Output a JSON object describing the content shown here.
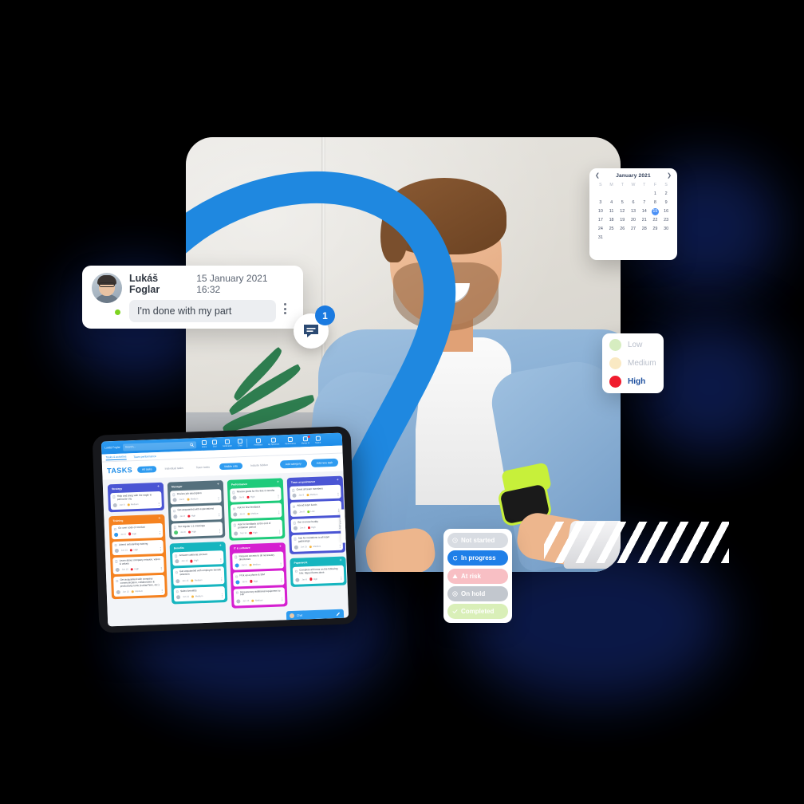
{
  "calendar": {
    "title": "January 2021",
    "prev_icon": "chevron-left-icon",
    "next_icon": "chevron-right-icon",
    "weekdays": [
      "S",
      "M",
      "T",
      "W",
      "T",
      "F",
      "S"
    ],
    "leading_blanks": 5,
    "days": [
      1,
      2,
      3,
      4,
      5,
      6,
      7,
      8,
      9,
      10,
      11,
      12,
      13,
      14,
      15,
      16,
      17,
      18,
      19,
      20,
      21,
      22,
      23,
      24,
      25,
      26,
      27,
      28,
      29,
      30,
      31
    ],
    "selected_day": 15,
    "accent": "#4a90f7"
  },
  "comment": {
    "author": "Lukáš Foglar",
    "timestamp": "15 January 2021 16:32",
    "message": "I'm done with my part",
    "menu_icon": "kebab-menu-icon",
    "online_status_color": "#7ed321",
    "chat_icon": "chat-bubble-icon",
    "unread_count": "1",
    "badge_color": "#1a7ae0"
  },
  "priority_legend": {
    "items": [
      {
        "label": "Low",
        "color": "#d6edc0"
      },
      {
        "label": "Medium",
        "color": "#fae9c3"
      },
      {
        "label": "High",
        "color": "#f01c2e"
      }
    ]
  },
  "statuses": {
    "items": [
      {
        "label": "Not started",
        "icon": "clock-icon",
        "bg": "#d8dce2",
        "fg": "#ffffff"
      },
      {
        "label": "In progress",
        "icon": "refresh-icon",
        "bg": "#1f7fe8",
        "fg": "#ffffff"
      },
      {
        "label": "At risk",
        "icon": "warning-icon",
        "bg": "#f8bfc4",
        "fg": "#ffffff"
      },
      {
        "label": "On hold",
        "icon": "pause-icon",
        "bg": "#c2c7ce",
        "fg": "#ffffff"
      },
      {
        "label": "Completed",
        "icon": "check-icon",
        "bg": "#d9efb8",
        "fg": "#ffffff"
      }
    ]
  },
  "tablet": {
    "toolbar": {
      "user": "Lukáš Foglar",
      "search_placeholder": "Search...",
      "search_icon": "search-icon",
      "icons": [
        {
          "label": "Home",
          "icon": "home-icon"
        },
        {
          "label": "Grid",
          "icon": "grid-icon"
        },
        {
          "label": "Notification",
          "icon": "bell-icon"
        },
        {
          "label": "Chat",
          "icon": "chat-icon"
        }
      ],
      "icons2": [
        {
          "label": "Feedback",
          "icon": "feedback-icon"
        },
        {
          "label": "My Spectrum",
          "icon": "spectrum-icon"
        },
        {
          "label": "Performance",
          "icon": "chart-icon"
        },
        {
          "label": "Mentor AI",
          "icon": "mentor-icon",
          "badge": true
        },
        {
          "label": "Switch",
          "icon": "switch-icon"
        }
      ]
    },
    "subnav": [
      {
        "label": "Tasks & activities",
        "active": true
      },
      {
        "label": "Team performance",
        "active": false
      }
    ],
    "header": {
      "title": "TASKS",
      "filters": [
        {
          "label": "All tasks",
          "active": true
        },
        {
          "label": "Individual tasks",
          "active": false
        },
        {
          "label": "Team tasks",
          "active": false
        }
      ],
      "visibility": [
        {
          "label": "Visible only",
          "active": true
        },
        {
          "label": "Include hidden",
          "active": false
        }
      ],
      "actions": [
        {
          "label": "Add category"
        },
        {
          "label": "Add new task"
        }
      ]
    },
    "side_tab": "Switch view",
    "chat_bar": {
      "label": "Chat",
      "edit_icon": "pencil-icon"
    },
    "columns": [
      {
        "name": "Strategy",
        "color": "#4a55d4",
        "cards": [
          {
            "title": "Help and bring with the eagle to particular city",
            "date": "Jan 8",
            "priority": "Medium",
            "priority_color": "#f5b642",
            "avatar": "gray"
          }
        ]
      },
      {
        "name": "Training",
        "color": "#f58220",
        "cards": [
          {
            "title": "Go over code of conduct",
            "date": "Jan 8",
            "priority": "High",
            "priority_color": "#f01c2e",
            "avatar": "blue"
          },
          {
            "title": "Attend onboarding training",
            "date": "Jan 15",
            "priority": "High",
            "priority_color": "#f01c2e",
            "avatar": "gray"
          },
          {
            "title": "Learn about company mission, vision & values",
            "date": "Jan 15",
            "priority": "High",
            "priority_color": "#f01c2e",
            "avatar": "gray"
          },
          {
            "title": "Get acquainted with company communication, collaboration & productivity tools (LudianTime, etc.)",
            "date": "Jan 15",
            "priority": "Medium",
            "priority_color": "#f5b642",
            "avatar": "gray"
          }
        ]
      },
      {
        "name": "Manager",
        "color": "#55707d",
        "cards": [
          {
            "title": "Review job description",
            "date": "Jan 8",
            "priority": "Medium",
            "priority_color": "#f5b642",
            "avatar": "gray"
          },
          {
            "title": "Get acquainted with expectations",
            "date": "Jan 8",
            "priority": "High",
            "priority_color": "#f01c2e",
            "avatar": "gray"
          },
          {
            "title": "Set regular 1:1 meetings",
            "date": "Jan 8",
            "priority": "High",
            "priority_color": "#f01c2e",
            "avatar": "green"
          }
        ]
      },
      {
        "name": "Benefits",
        "color": "#16b5bf",
        "cards": [
          {
            "title": "Activate cafeteria account",
            "date": "Jan 15",
            "priority": "High",
            "priority_color": "#f01c2e",
            "avatar": "gray"
          },
          {
            "title": "Get acquainted with employee benefit selection",
            "date": "Jan 15",
            "priority": "Medium",
            "priority_color": "#f5b642",
            "avatar": "gray"
          },
          {
            "title": "Select benefits",
            "date": "Jan 22",
            "priority": "Medium",
            "priority_color": "#f5b642",
            "avatar": "gray"
          }
        ]
      },
      {
        "name": "Performance",
        "color": "#1ecb7b",
        "cards": [
          {
            "title": "Review goals for the first 3 months",
            "date": "Jan 8",
            "priority": "High",
            "priority_color": "#f01c2e",
            "avatar": "gray"
          },
          {
            "title": "Ask for first feedback",
            "date": "Jan 8",
            "priority": "Medium",
            "priority_color": "#f5b642",
            "avatar": "gray"
          },
          {
            "title": "Ask for feedback at the end of probation period",
            "date": "Mar 31",
            "priority": "High",
            "priority_color": "#f01c2e",
            "avatar": "gray"
          }
        ]
      },
      {
        "name": "IT & software",
        "color": "#d51fd0",
        "cards": [
          {
            "title": "Request access to all necessary directories",
            "date": "Jan 8",
            "priority": "Medium",
            "priority_color": "#f5b642",
            "avatar": "blue"
          },
          {
            "title": "Pick up a phone & SIM",
            "date": "Jan 8",
            "priority": "High",
            "priority_color": "#f01c2e",
            "avatar": "blue"
          },
          {
            "title": "Request any additional equipment to HR",
            "date": "Jan 15",
            "priority": "Medium",
            "priority_color": "#f5b642",
            "avatar": "gray"
          }
        ]
      },
      {
        "name": "Team acquaintance",
        "color": "#4a55d4",
        "cards": [
          {
            "title": "Greet all team members",
            "date": "Jan 8",
            "priority": "Medium",
            "priority_color": "#f5b642",
            "avatar": "gray"
          },
          {
            "title": "Attend team lunch",
            "date": "Jan 8",
            "priority": "Low",
            "priority_color": "#7ed321",
            "avatar": "gray"
          },
          {
            "title": "Get to know buddy",
            "date": "Jan 8",
            "priority": "High",
            "priority_color": "#f01c2e",
            "avatar": "gray"
          },
          {
            "title": "Ask for invitations to all team gatherings",
            "date": "Jan 15",
            "priority": "Medium",
            "priority_color": "#f5b642",
            "avatar": "gray"
          }
        ]
      },
      {
        "name": "Paperwork",
        "color": "#16b5bf",
        "cards": [
          {
            "title": "Complete all forms on the following link: https://forms.done",
            "date": "Jan 8",
            "priority": "High",
            "priority_color": "#f01c2e",
            "avatar": "gray"
          }
        ]
      }
    ]
  }
}
